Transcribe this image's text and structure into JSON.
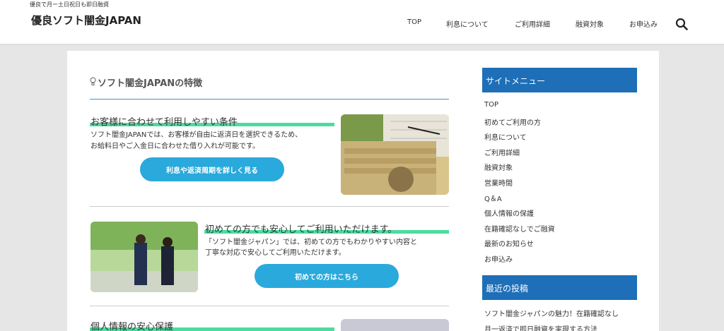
{
  "header": {
    "tagline": "優良で月ー土日祝日も即日融資",
    "site_title": "優良ソフト闇金JAPAN",
    "nav": [
      "TOP",
      "利息について",
      "ご利用詳細",
      "融資対象",
      "お申込み"
    ]
  },
  "main": {
    "section_title": "ソフト闇金JAPANの特徴",
    "features": [
      {
        "title": "お客様に合わせて利用しやすい条件",
        "lines": [
          "ソフト闇金JAPANでは、お客様が自由に返済日を選択できるため、",
          "お給料日やご入金日に合わせた借り入れが可能です。"
        ],
        "button": "利息や返済周期を詳しく見る"
      },
      {
        "title": "初めての方でも安心してご利用いただけます。",
        "lines": [
          "「ソフト闇金ジャパン」では、初めての方でもわかりやすい内容と",
          "丁寧な対応で安心してご利用いただけます。"
        ],
        "button": "初めての方はこちら"
      },
      {
        "title": "個人情報の安心保護"
      }
    ]
  },
  "sidebar": {
    "menu_title": "サイトメニュー",
    "menu": [
      "TOP",
      "初めてご利用の方",
      "利息について",
      "ご利用詳細",
      "融資対象",
      "営業時間",
      "Q＆A",
      "個人情報の保護",
      "在籍確認なしでご融資",
      "最新のお知らせ",
      "お申込み"
    ],
    "recent_title": "最近の投稿",
    "recent": [
      "ソフト闇金ジャパンの魅力！在籍確認なし",
      "月一返済で即日融資を実現する方法"
    ]
  },
  "colors": {
    "accent_blue": "#1e6fb8",
    "button_blue": "#2aa9dc",
    "underline_green": "#4bdc9e"
  }
}
